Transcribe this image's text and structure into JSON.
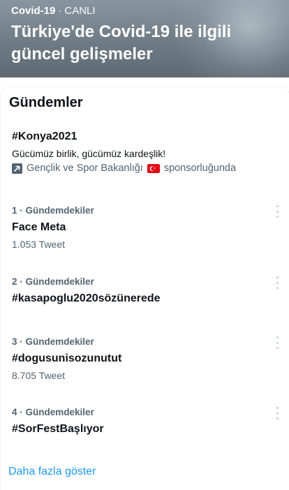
{
  "hero": {
    "topic": "Covid-19",
    "separator": "·",
    "status": "CANLI",
    "title": "Türkiye'de Covid-19 ile ilgili güncel gelişmeler"
  },
  "trends_section": {
    "title": "Gündemler",
    "promoted": {
      "hashtag": "#Konya2021",
      "description": "Gücümüz birlik, gücümüz kardeşlik!",
      "sponsor_name": "Gençlik ve Spor Bakanlığı",
      "sponsor_suffix": "sponsorluğunda",
      "promoted_icon": "promoted-arrow-icon",
      "flag_icon": "turkey-flag-icon"
    },
    "items": [
      {
        "label": "1 · Gündemdekiler",
        "name": "Face Meta",
        "count": "1.053 Tweet"
      },
      {
        "label": "2 · Gündemdekiler",
        "name": "#kasapoglu2020sözünerede",
        "count": ""
      },
      {
        "label": "3 · Gündemdekiler",
        "name": "#dogusunisozunutut",
        "count": "8.705 Tweet"
      },
      {
        "label": "4 · Gündemdekiler",
        "name": "#SorFestBaşlıyor",
        "count": ""
      }
    ],
    "show_more": "Daha fazla göster"
  },
  "colors": {
    "accent": "#1d9bf0",
    "secondary_text": "#536471",
    "primary_text": "#0f1419",
    "flag_red": "#e30a17"
  }
}
